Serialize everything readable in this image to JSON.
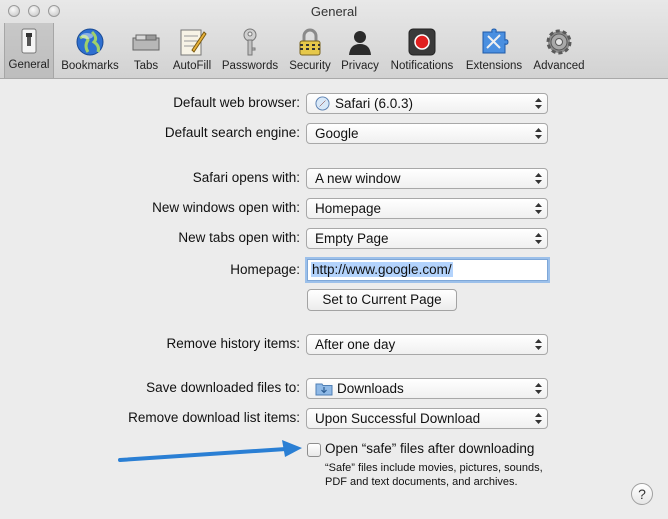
{
  "window": {
    "title": "General"
  },
  "toolbar": {
    "items": [
      {
        "label": "General",
        "icon": "general-switch-icon"
      },
      {
        "label": "Bookmarks",
        "icon": "globe-icon"
      },
      {
        "label": "Tabs",
        "icon": "tabs-icon"
      },
      {
        "label": "AutoFill",
        "icon": "pencil-form-icon"
      },
      {
        "label": "Passwords",
        "icon": "key-icon"
      },
      {
        "label": "Security",
        "icon": "padlock-icon"
      },
      {
        "label": "Privacy",
        "icon": "silhouette-icon"
      },
      {
        "label": "Notifications",
        "icon": "record-button-icon"
      },
      {
        "label": "Extensions",
        "icon": "puzzle-tools-icon"
      },
      {
        "label": "Advanced",
        "icon": "gear-icon"
      }
    ]
  },
  "general": {
    "default_browser": {
      "label": "Default web browser:",
      "value": "Safari (6.0.3)"
    },
    "search_engine": {
      "label": "Default search engine:",
      "value": "Google"
    },
    "opens_with": {
      "label": "Safari opens with:",
      "value": "A new window"
    },
    "new_windows": {
      "label": "New windows open with:",
      "value": "Homepage"
    },
    "new_tabs": {
      "label": "New tabs open with:",
      "value": "Empty Page"
    },
    "homepage": {
      "label": "Homepage:",
      "value": "http://www.google.com/"
    },
    "set_current_button": "Set to Current Page",
    "remove_history": {
      "label": "Remove history items:",
      "value": "After one day"
    },
    "save_downloads": {
      "label": "Save downloaded files to:",
      "value": "Downloads"
    },
    "remove_downloads": {
      "label": "Remove download list items:",
      "value": "Upon Successful Download"
    },
    "open_safe": {
      "label": "Open “safe” files after downloading",
      "checked": false,
      "note_line1": "“Safe” files include movies, pictures, sounds,",
      "note_line2": "PDF and text documents, and archives."
    },
    "help_label": "?"
  },
  "colors": {
    "annotation_arrow": "#2a7fd4",
    "focus_ring": "#9cc0ea"
  }
}
